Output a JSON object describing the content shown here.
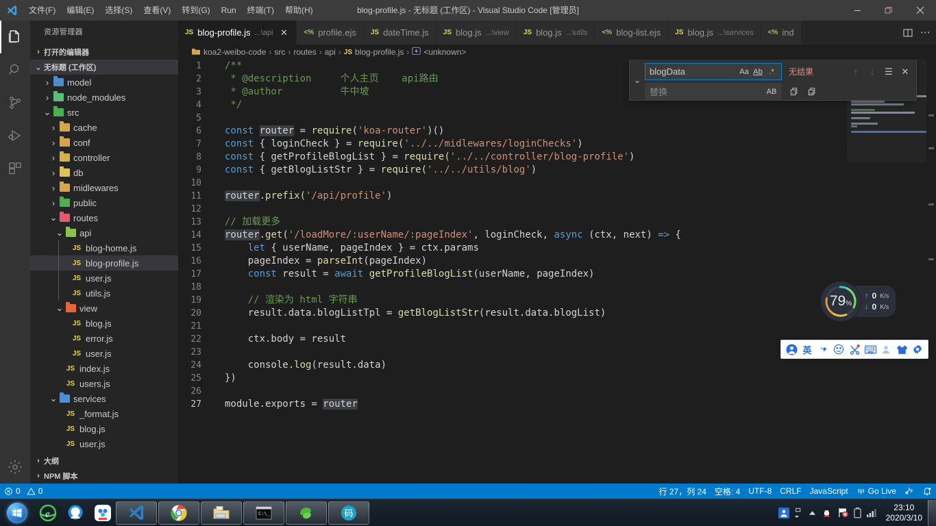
{
  "titlebar": {
    "logo_icon": "vscode-logo-icon",
    "title": "blog-profile.js - 无标题 (工作区) - Visual Studio Code [管理员]",
    "menus": [
      {
        "label": "文件(F)",
        "name": "menu-file"
      },
      {
        "label": "编辑(E)",
        "name": "menu-edit"
      },
      {
        "label": "选择(S)",
        "name": "menu-selection"
      },
      {
        "label": "查看(V)",
        "name": "menu-view"
      },
      {
        "label": "转到(G)",
        "name": "menu-go"
      },
      {
        "label": "Run",
        "name": "menu-run"
      },
      {
        "label": "终端(T)",
        "name": "menu-terminal"
      },
      {
        "label": "帮助(H)",
        "name": "menu-help"
      }
    ],
    "window_controls": {
      "minimize": "—",
      "restore": "❐",
      "close": "✕"
    }
  },
  "activitybar": {
    "items": [
      {
        "name": "activity-explorer",
        "icon": "files-icon",
        "active": true
      },
      {
        "name": "activity-search",
        "icon": "search-icon",
        "active": false
      },
      {
        "name": "activity-scm",
        "icon": "source-control-icon",
        "active": false
      },
      {
        "name": "activity-debug",
        "icon": "run-and-debug-icon",
        "active": false
      },
      {
        "name": "activity-extensions",
        "icon": "extensions-icon",
        "active": false
      }
    ],
    "manage": {
      "name": "activity-manage",
      "icon": "gear-icon"
    }
  },
  "sidebar": {
    "title": "资源管理器",
    "sections": [
      {
        "label": "打开的编辑器",
        "expanded": false
      },
      {
        "label": "无标题 (工作区)",
        "expanded": true
      }
    ],
    "tree": [
      {
        "label": "model",
        "type": "folder",
        "depth": 1,
        "expanded": false,
        "color": "#4f8ccc",
        "selected": false
      },
      {
        "label": "node_modules",
        "type": "folder",
        "depth": 1,
        "expanded": false,
        "color": "#5bbd7a",
        "selected": false
      },
      {
        "label": "src",
        "type": "folder",
        "depth": 1,
        "expanded": true,
        "color": "#4caf50",
        "selected": false
      },
      {
        "label": "cache",
        "type": "folder",
        "depth": 2,
        "expanded": false,
        "color": "#d7a64b",
        "selected": false
      },
      {
        "label": "conf",
        "type": "folder",
        "depth": 2,
        "expanded": false,
        "color": "#d7a64b",
        "selected": false
      },
      {
        "label": "controller",
        "type": "folder",
        "depth": 2,
        "expanded": false,
        "color": "#d7b04b",
        "selected": false
      },
      {
        "label": "db",
        "type": "folder",
        "depth": 2,
        "expanded": false,
        "color": "#e0c158",
        "selected": false
      },
      {
        "label": "midlewares",
        "type": "folder",
        "depth": 2,
        "expanded": false,
        "color": "#d7a64b",
        "selected": false
      },
      {
        "label": "public",
        "type": "folder",
        "depth": 2,
        "expanded": false,
        "color": "#4caf50",
        "selected": false
      },
      {
        "label": "routes",
        "type": "folder",
        "depth": 2,
        "expanded": true,
        "color": "#e05c6e",
        "selected": false
      },
      {
        "label": "api",
        "type": "folder",
        "depth": 3,
        "expanded": true,
        "color": "#8bc34a",
        "selected": false
      },
      {
        "label": "blog-home.js",
        "type": "js",
        "depth": 4,
        "selected": false
      },
      {
        "label": "blog-profile.js",
        "type": "js",
        "depth": 4,
        "selected": true
      },
      {
        "label": "user.js",
        "type": "js",
        "depth": 4,
        "selected": false
      },
      {
        "label": "utils.js",
        "type": "js",
        "depth": 4,
        "selected": false
      },
      {
        "label": "view",
        "type": "folder",
        "depth": 3,
        "expanded": true,
        "color": "#e8643c",
        "selected": false
      },
      {
        "label": "blog.js",
        "type": "js",
        "depth": 4,
        "selected": false
      },
      {
        "label": "error.js",
        "type": "js",
        "depth": 4,
        "selected": false
      },
      {
        "label": "user.js",
        "type": "js",
        "depth": 4,
        "selected": false
      },
      {
        "label": "index.js",
        "type": "js",
        "depth": 3,
        "selected": false
      },
      {
        "label": "users.js",
        "type": "js",
        "depth": 3,
        "selected": false
      },
      {
        "label": "services",
        "type": "folder",
        "depth": 2,
        "expanded": true,
        "color": "#4a90d9",
        "selected": false
      },
      {
        "label": "_format.js",
        "type": "js",
        "depth": 3,
        "selected": false
      },
      {
        "label": "blog.js",
        "type": "js",
        "depth": 3,
        "selected": false
      },
      {
        "label": "user.js",
        "type": "js",
        "depth": 3,
        "selected": false
      }
    ],
    "bottom_sections": [
      {
        "label": "大纲",
        "expanded": false
      },
      {
        "label": "NPM 脚本",
        "expanded": false
      }
    ]
  },
  "tabs": [
    {
      "label": "blog-profile.js",
      "desc": "...\\api",
      "icon": "js-icon",
      "active": true,
      "close": "✕"
    },
    {
      "label": "profile.ejs",
      "desc": "",
      "icon": "ejs-icon",
      "active": false
    },
    {
      "label": "dateTime.js",
      "desc": "",
      "icon": "js-icon",
      "active": false
    },
    {
      "label": "blog.js",
      "desc": "...\\view",
      "icon": "js-icon",
      "active": false
    },
    {
      "label": "blog.js",
      "desc": "...\\utils",
      "icon": "js-icon",
      "active": false
    },
    {
      "label": "blog-list.ejs",
      "desc": "",
      "icon": "ejs-icon",
      "active": false
    },
    {
      "label": "blog.js",
      "desc": "...\\services",
      "icon": "js-icon",
      "active": false
    },
    {
      "label": "ind",
      "desc": "",
      "icon": "ejs-icon",
      "active": false
    }
  ],
  "tabs_actions": {
    "split_editor": "split-editor-icon",
    "more": "more-actions-icon"
  },
  "breadcrumbs": [
    {
      "label": "koa2-weibo-code",
      "icon": "folder-icon"
    },
    {
      "label": "src",
      "icon": ""
    },
    {
      "label": "routes",
      "icon": ""
    },
    {
      "label": "api",
      "icon": ""
    },
    {
      "label": "blog-profile.js",
      "icon": "js-icon"
    },
    {
      "label": "<unknown>",
      "icon": "symbol-icon"
    }
  ],
  "find_widget": {
    "search_value": "blogData",
    "replace_placeholder": "替换",
    "result_text": "无结果",
    "result_color": "#f48771",
    "toggle_icon": "chevron-down-icon",
    "options": [
      {
        "name": "match-case-toggle",
        "glyph": "Aa"
      },
      {
        "name": "match-whole-word-toggle",
        "glyph": "Ab"
      },
      {
        "name": "use-regex-toggle",
        "glyph": ".*"
      }
    ],
    "replace_options": [
      {
        "name": "preserve-case-toggle",
        "glyph": "AB"
      }
    ],
    "nav": [
      {
        "name": "previous-match-button",
        "glyph": "↑"
      },
      {
        "name": "next-match-button",
        "glyph": "↓"
      },
      {
        "name": "find-in-selection-button",
        "glyph": "☰"
      },
      {
        "name": "close-find-button",
        "glyph": "✕"
      }
    ],
    "replace_actions": [
      {
        "name": "replace-button",
        "glyph": "⎘"
      },
      {
        "name": "replace-all-button",
        "glyph": "⎗"
      }
    ]
  },
  "code": {
    "filename": "blog-profile.js",
    "current_line": 27,
    "lines": [
      {
        "n": 1,
        "tokens": [
          {
            "t": "/**",
            "c": "c"
          }
        ]
      },
      {
        "n": 2,
        "tokens": [
          {
            "t": " * @description     个人主页    api路由",
            "c": "c"
          }
        ]
      },
      {
        "n": 3,
        "tokens": [
          {
            "t": " * @author          牛中坡",
            "c": "c"
          }
        ]
      },
      {
        "n": 4,
        "tokens": [
          {
            "t": " */",
            "c": "c"
          }
        ]
      },
      {
        "n": 5,
        "tokens": []
      },
      {
        "n": 6,
        "tokens": [
          {
            "t": "const ",
            "c": "k"
          },
          {
            "t": "router",
            "c": "hl"
          },
          {
            "t": " = ",
            "c": "p"
          },
          {
            "t": "require",
            "c": "f"
          },
          {
            "t": "(",
            "c": "p"
          },
          {
            "t": "'koa-router'",
            "c": "s"
          },
          {
            "t": ")()",
            "c": "p"
          }
        ]
      },
      {
        "n": 7,
        "tokens": [
          {
            "t": "const ",
            "c": "k"
          },
          {
            "t": "{ loginCheck } = ",
            "c": "p"
          },
          {
            "t": "require",
            "c": "f"
          },
          {
            "t": "(",
            "c": "p"
          },
          {
            "t": "'../../midlewares/loginChecks'",
            "c": "s"
          },
          {
            "t": ")",
            "c": "p"
          }
        ]
      },
      {
        "n": 8,
        "tokens": [
          {
            "t": "const ",
            "c": "k"
          },
          {
            "t": "{ getProfileBlogList } = ",
            "c": "p"
          },
          {
            "t": "require",
            "c": "f"
          },
          {
            "t": "(",
            "c": "p"
          },
          {
            "t": "'../../controller/blog-profile'",
            "c": "s"
          },
          {
            "t": ")",
            "c": "p"
          }
        ]
      },
      {
        "n": 9,
        "tokens": [
          {
            "t": "const ",
            "c": "k"
          },
          {
            "t": "{ getBlogListStr } = ",
            "c": "p"
          },
          {
            "t": "require",
            "c": "f"
          },
          {
            "t": "(",
            "c": "p"
          },
          {
            "t": "'../../utils/blog'",
            "c": "s"
          },
          {
            "t": ")",
            "c": "p"
          }
        ]
      },
      {
        "n": 10,
        "tokens": []
      },
      {
        "n": 11,
        "tokens": [
          {
            "t": "router",
            "c": "hl"
          },
          {
            "t": ".",
            "c": "p"
          },
          {
            "t": "prefix",
            "c": "f"
          },
          {
            "t": "(",
            "c": "p"
          },
          {
            "t": "'/api/profile'",
            "c": "s"
          },
          {
            "t": ")",
            "c": "p"
          }
        ]
      },
      {
        "n": 12,
        "tokens": []
      },
      {
        "n": 13,
        "tokens": [
          {
            "t": "// 加载更多",
            "c": "c"
          }
        ]
      },
      {
        "n": 14,
        "tokens": [
          {
            "t": "router",
            "c": "hl"
          },
          {
            "t": ".",
            "c": "p"
          },
          {
            "t": "get",
            "c": "f"
          },
          {
            "t": "(",
            "c": "p"
          },
          {
            "t": "'/loadMore/:userName/:pageIndex'",
            "c": "s"
          },
          {
            "t": ", loginCheck, ",
            "c": "p"
          },
          {
            "t": "async ",
            "c": "k"
          },
          {
            "t": "(ctx, next) ",
            "c": "p"
          },
          {
            "t": "=>",
            "c": "k"
          },
          {
            "t": " {",
            "c": "p"
          }
        ]
      },
      {
        "n": 15,
        "tokens": [
          {
            "t": "    ",
            "c": "p"
          },
          {
            "t": "let",
            "c": "k"
          },
          {
            "t": " { userName, pageIndex } = ctx.params",
            "c": "p"
          }
        ]
      },
      {
        "n": 16,
        "tokens": [
          {
            "t": "    pageIndex = ",
            "c": "p"
          },
          {
            "t": "parseInt",
            "c": "f"
          },
          {
            "t": "(pageIndex)",
            "c": "p"
          }
        ]
      },
      {
        "n": 17,
        "tokens": [
          {
            "t": "    ",
            "c": "p"
          },
          {
            "t": "const",
            "c": "k"
          },
          {
            "t": " result = ",
            "c": "p"
          },
          {
            "t": "await",
            "c": "k"
          },
          {
            "t": " ",
            "c": "p"
          },
          {
            "t": "getProfileBlogList",
            "c": "f"
          },
          {
            "t": "(userName, pageIndex)",
            "c": "p"
          }
        ]
      },
      {
        "n": 18,
        "tokens": []
      },
      {
        "n": 19,
        "tokens": [
          {
            "t": "    // 渲染为 html 字符串",
            "c": "c"
          }
        ]
      },
      {
        "n": 20,
        "tokens": [
          {
            "t": "    result.data.blogListTpl = ",
            "c": "p"
          },
          {
            "t": "getBlogListStr",
            "c": "f"
          },
          {
            "t": "(result.data.blogList)",
            "c": "p"
          }
        ]
      },
      {
        "n": 21,
        "tokens": []
      },
      {
        "n": 22,
        "tokens": [
          {
            "t": "    ctx.body = result",
            "c": "p"
          }
        ]
      },
      {
        "n": 23,
        "tokens": []
      },
      {
        "n": 24,
        "tokens": [
          {
            "t": "    console.",
            "c": "p"
          },
          {
            "t": "log",
            "c": "f"
          },
          {
            "t": "(result.data)",
            "c": "p"
          }
        ]
      },
      {
        "n": 25,
        "tokens": [
          {
            "t": "})",
            "c": "p"
          }
        ]
      },
      {
        "n": 26,
        "tokens": []
      },
      {
        "n": 27,
        "tokens": [
          {
            "t": "module.exports = ",
            "c": "p"
          },
          {
            "t": "router",
            "c": "hl"
          }
        ]
      }
    ]
  },
  "network_monitor": {
    "percent": "79",
    "percent_unit": "%",
    "upload": {
      "value": "0",
      "unit": "K/s",
      "icon": "arrow-up-icon"
    },
    "download": {
      "value": "0",
      "unit": "K/s",
      "icon": "arrow-down-icon"
    }
  },
  "ime_toolbar": {
    "items": [
      {
        "name": "ime-logo-icon",
        "glyph": "👤"
      },
      {
        "name": "ime-language-icon",
        "glyph": "英"
      },
      {
        "name": "ime-punctuation-icon",
        "glyph": "，"
      },
      {
        "name": "ime-emoji-icon",
        "glyph": "☺"
      },
      {
        "name": "ime-screenshot-icon",
        "glyph": "✂"
      },
      {
        "name": "ime-keyboard-icon",
        "glyph": "⌨"
      },
      {
        "name": "ime-user-icon",
        "glyph": "👤"
      },
      {
        "name": "ime-skin-icon",
        "glyph": "👕"
      },
      {
        "name": "ime-settings-icon",
        "glyph": "⚙"
      }
    ]
  },
  "statusbar": {
    "left": [
      {
        "name": "status-errors",
        "icon": "error-icon",
        "label": "0"
      },
      {
        "name": "status-warnings",
        "icon": "warning-icon",
        "label": "0"
      }
    ],
    "right": [
      {
        "name": "status-cursor-position",
        "label": "行 27，列 24"
      },
      {
        "name": "status-indentation",
        "label": "空格: 4"
      },
      {
        "name": "status-encoding",
        "label": "UTF-8"
      },
      {
        "name": "status-eol",
        "label": "CRLF"
      },
      {
        "name": "status-language-mode",
        "label": "JavaScript"
      },
      {
        "name": "status-go-live",
        "label": "Go Live",
        "icon": "broadcast-icon"
      },
      {
        "name": "status-feedback",
        "label": "",
        "icon": "tweet-feedback-icon"
      },
      {
        "name": "status-notifications",
        "label": "",
        "icon": "bell-dot-icon"
      }
    ]
  },
  "taskbar": {
    "start": {
      "name": "start-orb",
      "icon": "windows-logo-icon"
    },
    "quicklaunch": [
      {
        "name": "taskbar-ie-icon",
        "glyph": "e"
      },
      {
        "name": "taskbar-qq-browser-icon",
        "glyph": "Q"
      },
      {
        "name": "taskbar-baidu-netdisk-icon",
        "glyph": "⊛"
      }
    ],
    "windows": [
      {
        "name": "taskbar-vscode",
        "icon": "vscode-icon",
        "active": true
      },
      {
        "name": "taskbar-chrome",
        "icon": "chrome-icon",
        "active": false
      },
      {
        "name": "taskbar-explorer",
        "icon": "file-explorer-icon",
        "active": false
      },
      {
        "name": "taskbar-cmd",
        "icon": "command-prompt-icon",
        "active": false
      },
      {
        "name": "taskbar-wechat-devtool",
        "icon": "green-app-icon",
        "active": false
      },
      {
        "name": "taskbar-app",
        "icon": "码-app-icon",
        "active": false
      }
    ],
    "tray": [
      {
        "name": "tray-ime-icon",
        "glyph": "👤"
      },
      {
        "name": "tray-expand-icon",
        "glyph": "▴"
      },
      {
        "name": "tray-qq-icon",
        "glyph": "🐧"
      },
      {
        "name": "tray-security-icon",
        "glyph": "⚑"
      },
      {
        "name": "tray-battery-icon",
        "glyph": "▯"
      },
      {
        "name": "tray-network-icon",
        "glyph": "▂▄▆"
      },
      {
        "name": "tray-volume-icon",
        "glyph": "🔊"
      }
    ],
    "clock": {
      "time": "23:10",
      "date": "2020/3/10"
    }
  },
  "colors": {
    "accent": "#007acc",
    "editor_bg": "#1e1e1e",
    "sidebar_bg": "#252526",
    "activitybar_bg": "#333333",
    "titlebar_bg": "#3c3c3c",
    "find_error": "#f48771",
    "js_yellow": "#e8d44d"
  }
}
